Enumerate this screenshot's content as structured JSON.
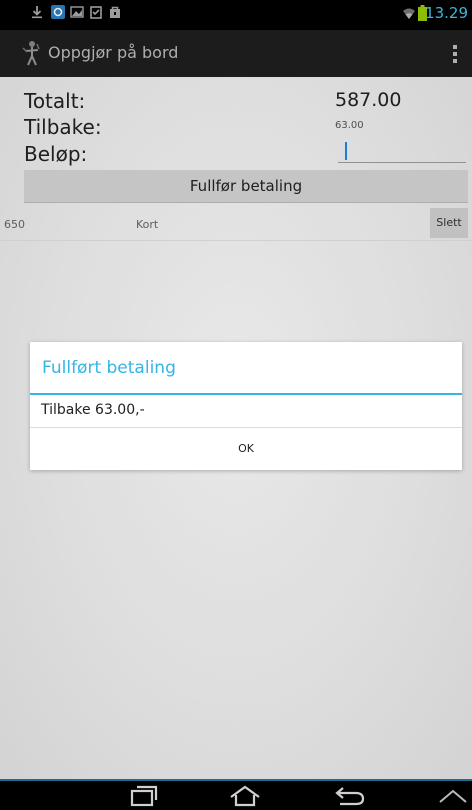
{
  "status_bar": {
    "time": "13.29",
    "icons": [
      "download-icon",
      "sync-icon",
      "image-icon",
      "clipboard-icon",
      "shopping-bag-icon",
      "wifi-icon",
      "battery-icon"
    ]
  },
  "action_bar": {
    "title": "Oppgjør på bord"
  },
  "summary": {
    "total_label": "Totalt:",
    "total_value": "587.00",
    "change_label": "Tilbake:",
    "change_value": "63.00",
    "amount_label": "Beløp:",
    "amount_value": ""
  },
  "finish_button": "Fullfør betaling",
  "payments": [
    {
      "amount": "650",
      "method": "Kort",
      "delete_label": "Slett"
    }
  ],
  "dialog": {
    "title": "Fullført betaling",
    "message": "Tilbake 63.00,-",
    "ok_label": "OK"
  },
  "nav_bar": {
    "buttons": [
      "recent-apps-icon",
      "home-icon",
      "back-icon",
      "chevron-up-icon"
    ]
  },
  "colors": {
    "accent": "#33b5e5",
    "status_text": "#3fc6ec",
    "battery": "#99cc00"
  }
}
